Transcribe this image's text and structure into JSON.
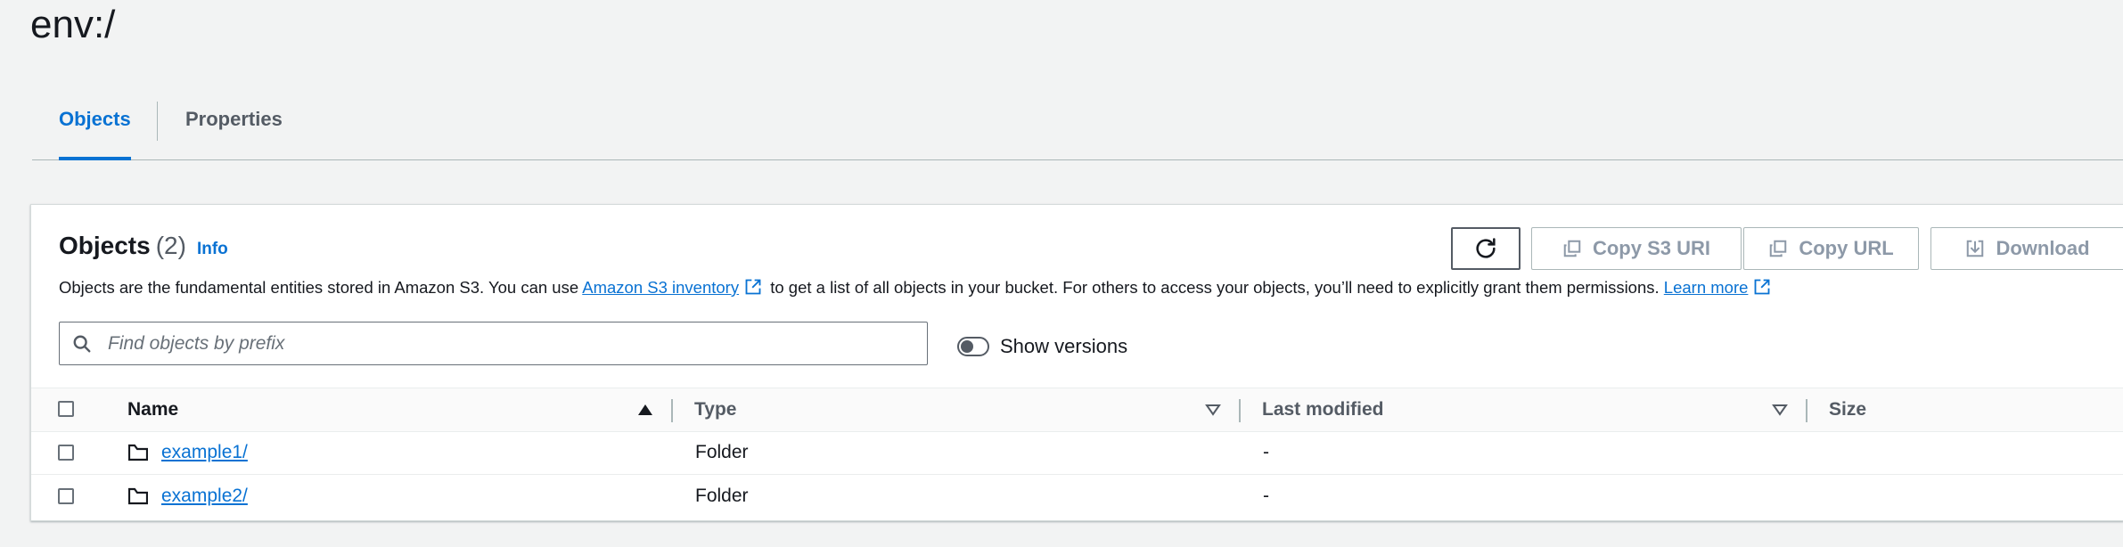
{
  "page": {
    "title": "env:/"
  },
  "tabs": [
    {
      "label": "Objects",
      "active": true
    },
    {
      "label": "Properties",
      "active": false
    }
  ],
  "panel": {
    "title": "Objects",
    "count": "(2)",
    "info_label": "Info",
    "description": {
      "part1": "Objects are the fundamental entities stored in Amazon S3. You can use ",
      "link1": "Amazon S3 inventory",
      "part2": " to get a list of all objects in your bucket. For others to access your objects, you’ll need to explicitly grant them permissions. ",
      "link2": "Learn more"
    },
    "buttons": {
      "copy_s3_uri": "Copy S3 URI",
      "copy_url": "Copy URL",
      "download": "Download"
    },
    "search": {
      "placeholder": "Find objects by prefix",
      "value": ""
    },
    "show_versions": {
      "label": "Show versions",
      "on": false
    }
  },
  "table": {
    "columns": [
      "Name",
      "Type",
      "Last modified",
      "Size"
    ],
    "rows": [
      {
        "name": "example1/",
        "type": "Folder",
        "last_modified": "-",
        "size": ""
      },
      {
        "name": "example2/",
        "type": "Folder",
        "last_modified": "-",
        "size": ""
      }
    ]
  },
  "colors": {
    "accent": "#0972d3",
    "text": "#16191f",
    "muted": "#545b64",
    "background": "#f2f3f3"
  },
  "icons": [
    "refresh-icon",
    "copy-icon",
    "download-icon",
    "search-icon",
    "external-link-icon",
    "folder-icon",
    "sort-ascending-icon",
    "sort-descending-icon"
  ]
}
